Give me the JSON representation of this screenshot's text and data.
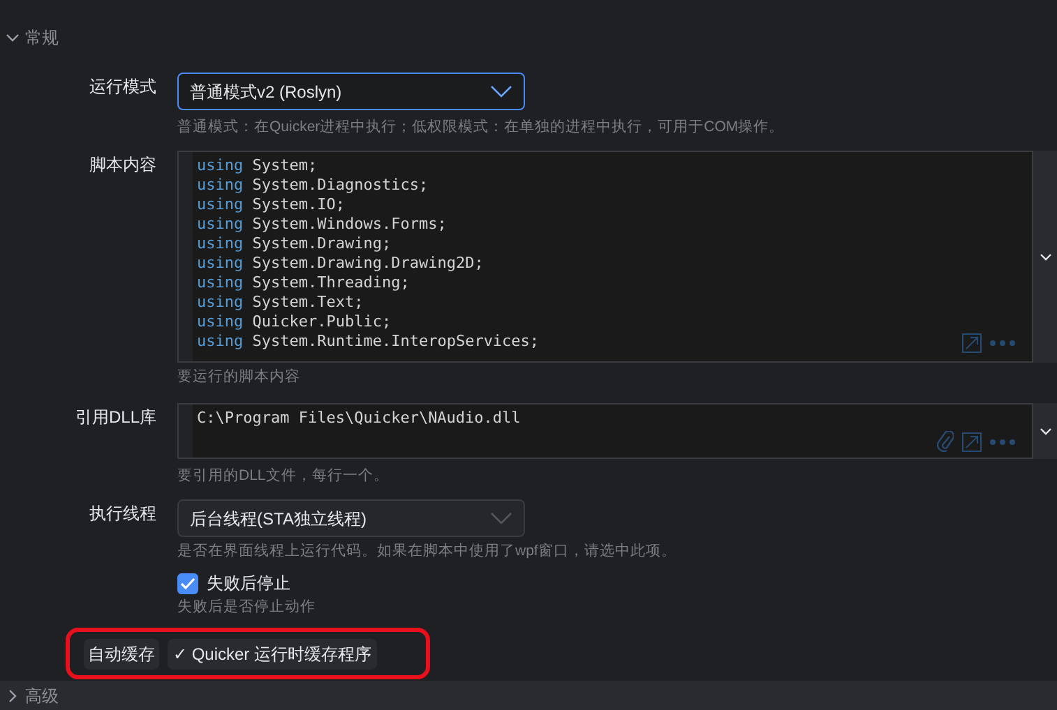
{
  "sections": [
    {
      "title": "常规",
      "expanded": true
    },
    {
      "title": "高级",
      "expanded": false
    }
  ],
  "run_mode": {
    "label": "运行模式",
    "value": "普通模式v2 (Roslyn)",
    "focused": true,
    "hint": "普通模式：在Quicker进程中执行；低权限模式：在单独的进程中执行，可用于COM操作。"
  },
  "script": {
    "label": "脚本内容",
    "lines": [
      {
        "keyword": "using",
        "text": "System;"
      },
      {
        "keyword": "using",
        "text": "System.Diagnostics;"
      },
      {
        "keyword": "using",
        "text": "System.IO;"
      },
      {
        "keyword": "using",
        "text": "System.Windows.Forms;"
      },
      {
        "keyword": "using",
        "text": "System.Drawing;"
      },
      {
        "keyword": "using",
        "text": "System.Drawing.Drawing2D;"
      },
      {
        "keyword": "using",
        "text": "System.Threading;"
      },
      {
        "keyword": "using",
        "text": "System.Text;"
      },
      {
        "keyword": "using",
        "text": "Quicker.Public;"
      },
      {
        "keyword": "using",
        "text": "System.Runtime.InteropServices;"
      }
    ],
    "hint": "要运行的脚本内容"
  },
  "dll": {
    "label": "引用DLL库",
    "value": "C:\\Program Files\\Quicker\\NAudio.dll",
    "hint": "要引用的DLL文件，每行一个。"
  },
  "thread": {
    "label": "执行线程",
    "value": "后台线程(STA独立线程)",
    "focused": false,
    "hint": "是否在界面线程上运行代码。如果在脚本中使用了wpf窗口，请选中此项。"
  },
  "stop_on_fail": {
    "label": "失败后停止",
    "checked": true,
    "hint": "失败后是否停止动作"
  },
  "auto_cache": {
    "label": "自动缓存",
    "tag": "✓ Quicker 运行时缓存程序",
    "highlighted": true
  }
}
